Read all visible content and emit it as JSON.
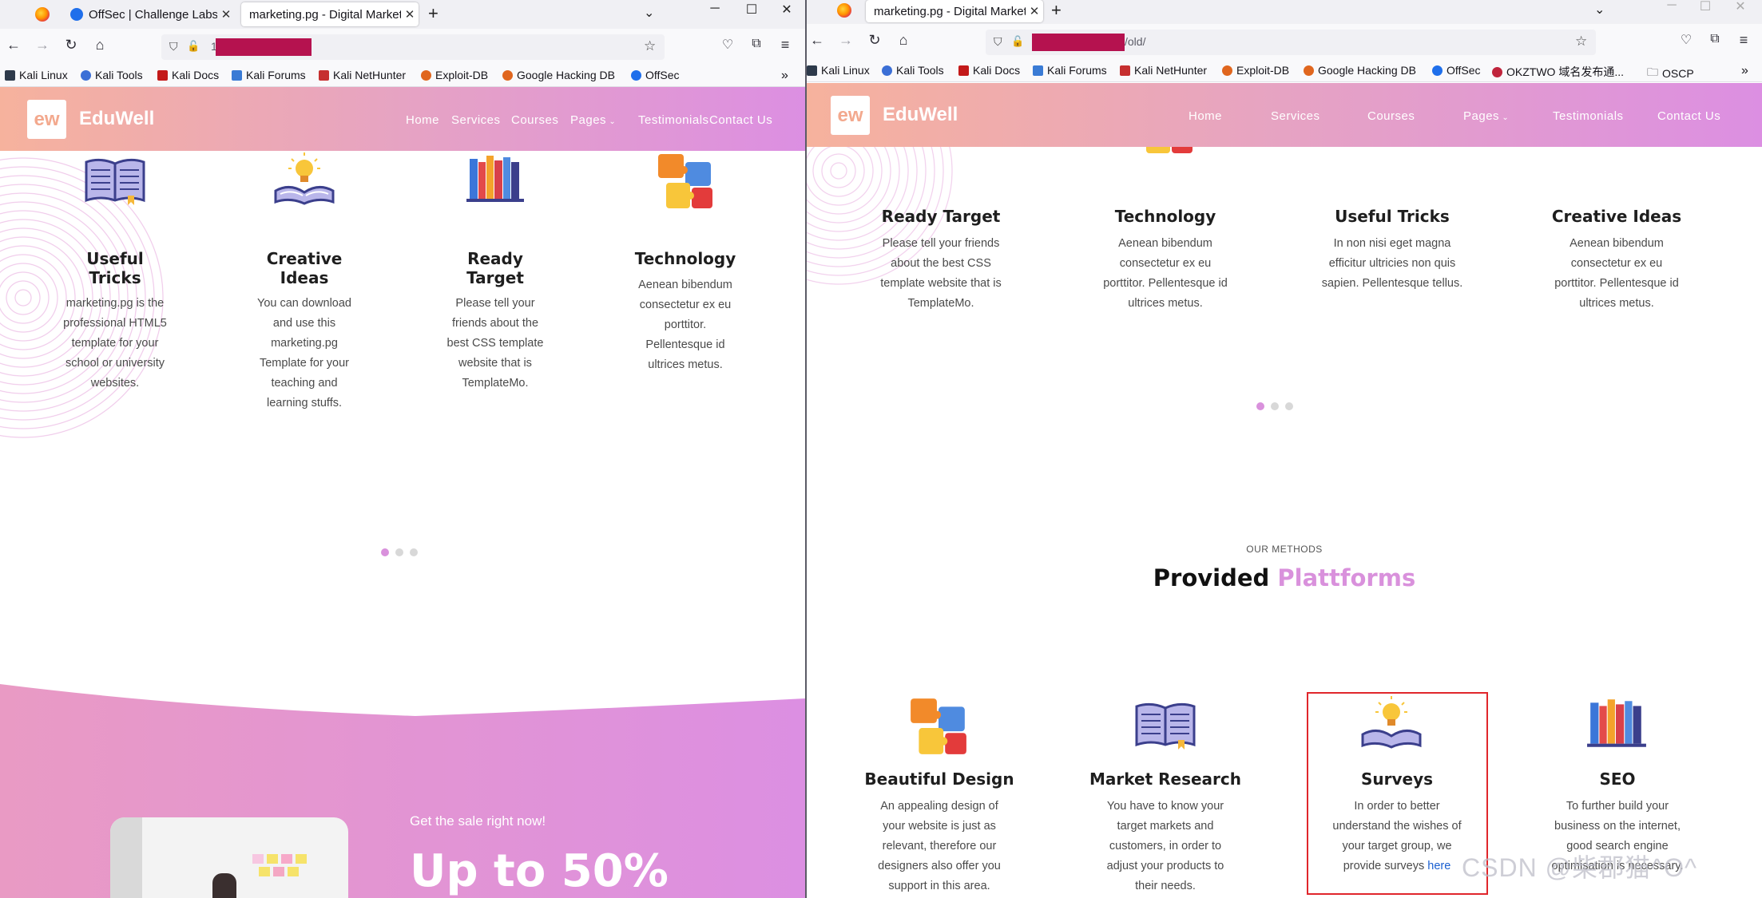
{
  "left": {
    "tabs": [
      {
        "title": "OffSec | Challenge Labs"
      },
      {
        "title": "marketing.pg - Digital Market"
      }
    ],
    "url_prefix": "1",
    "bookmarks": [
      "Kali Linux",
      "Kali Tools",
      "Kali Docs",
      "Kali Forums",
      "Kali NetHunter",
      "Exploit-DB",
      "Google Hacking DB",
      "OffSec"
    ],
    "brand": {
      "logo": "ew",
      "name": "EduWell"
    },
    "menu": [
      "Home",
      "Services",
      "Courses",
      "Pages",
      "Testimonials",
      "Contact Us"
    ],
    "cards": [
      {
        "title_l1": "Useful",
        "title_l2": "Tricks",
        "desc": [
          "marketing.pg is the",
          "professional HTML5",
          "template for your",
          "school or university",
          "websites."
        ]
      },
      {
        "title_l1": "Creative",
        "title_l2": "Ideas",
        "desc": [
          "You can download",
          "and use this",
          "marketing.pg",
          "Template for your",
          "teaching and",
          "learning stuffs."
        ]
      },
      {
        "title_l1": "Ready",
        "title_l2": "Target",
        "desc": [
          "Please tell your",
          "friends about the",
          "best CSS template",
          "website that is",
          "TemplateMo."
        ]
      },
      {
        "title_l1": "Technology",
        "title_l2": "",
        "desc": [
          "Aenean bibendum",
          "consectetur ex eu",
          "porttitor.",
          "Pellentesque id",
          "ultrices metus."
        ]
      }
    ],
    "promo": {
      "kicker": "Get the sale right now!",
      "headline": "Up to 50%"
    }
  },
  "right": {
    "tabs": [
      {
        "title": "marketing.pg - Digital Market"
      }
    ],
    "url_suffix": "/old/",
    "bookmarks": [
      "Kali Linux",
      "Kali Tools",
      "Kali Docs",
      "Kali Forums",
      "Kali NetHunter",
      "Exploit-DB",
      "Google Hacking DB",
      "OffSec",
      "OKZTWO 域名发布通...",
      "OSCP"
    ],
    "brand": {
      "logo": "ew",
      "name": "EduWell"
    },
    "menu": [
      "Home",
      "Services",
      "Courses",
      "Pages",
      "Testimonials",
      "Contact Us"
    ],
    "cards": [
      {
        "title": "Ready Target",
        "desc": [
          "Please tell your friends",
          "about the best CSS",
          "template website that is",
          "TemplateMo."
        ]
      },
      {
        "title": "Technology",
        "desc": [
          "Aenean bibendum",
          "consectetur ex eu",
          "porttitor. Pellentesque id",
          "ultrices metus."
        ]
      },
      {
        "title": "Useful Tricks",
        "desc": [
          "In non nisi eget magna",
          "efficitur ultricies non quis",
          "sapien. Pellentesque tellus."
        ]
      },
      {
        "title": "Creative Ideas",
        "desc": [
          "Aenean bibendum",
          "consectetur ex eu",
          "porttitor. Pellentesque id",
          "ultrices metus."
        ]
      }
    ],
    "methods": {
      "kicker": "OUR METHODS",
      "heading_a": "Provided",
      "heading_b": "Plattforms"
    },
    "platforms": [
      {
        "title": "Beautiful Design",
        "desc": [
          "An appealing design of",
          "your website is just as",
          "relevant, therefore our",
          "designers also offer you",
          "support in this area."
        ]
      },
      {
        "title": "Market Research",
        "desc": [
          "You have to know your",
          "target markets and",
          "customers, in order to",
          "adjust your products to",
          "their needs."
        ]
      },
      {
        "title": "Surveys",
        "desc": [
          "In order to better",
          "understand the wishes of",
          "your target group, we"
        ],
        "last_pre": "provide surveys ",
        "link": "here"
      },
      {
        "title": "SEO",
        "desc": [
          "To further build your",
          "business on the internet,",
          "good search engine",
          "optimisation is necessary."
        ]
      }
    ],
    "watermark": "CSDN @柴郡猫^O^"
  },
  "colors": {
    "pink_accent": "#d991dc",
    "header_from": "#f6b29d",
    "header_to": "#dc8fe2",
    "redact": "#b5124f",
    "highlight_box": "#e0262b",
    "link": "#1a5fd0"
  }
}
